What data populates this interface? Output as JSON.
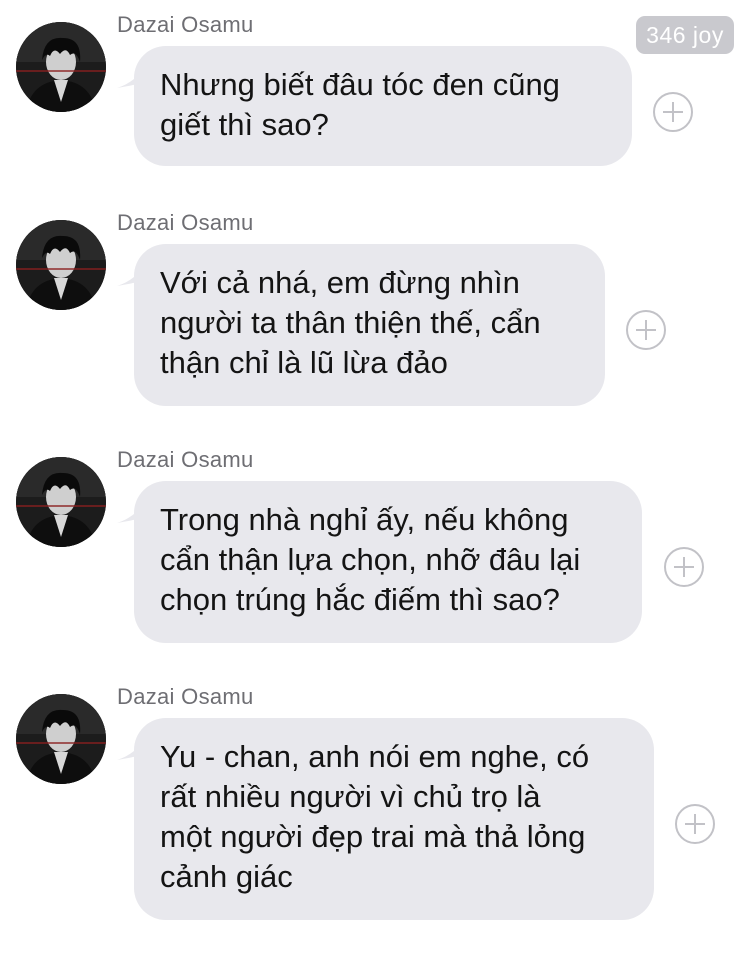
{
  "badge": {
    "label": "346 joy"
  },
  "messages": [
    {
      "sender": "Dazai Osamu",
      "text": "Nhưng biết đâu tóc đen cũng\ngiết thì sao?"
    },
    {
      "sender": "Dazai Osamu",
      "text": "Với cả nhá, em đừng nhìn\nngười ta thân thiện thế, cẩn\nthận chỉ là lũ lừa đảo"
    },
    {
      "sender": "Dazai Osamu",
      "text": "Trong nhà nghỉ ấy, nếu không\ncẩn thận lựa chọn, nhỡ đâu lại\nchọn trúng hắc điếm thì sao?"
    },
    {
      "sender": "Dazai Osamu",
      "text": "Yu - chan, anh nói em nghe, có\nrất nhiều người vì chủ trọ là\nmột người đẹp trai mà thả lỏng\ncảnh giác"
    }
  ],
  "icons": {
    "avatar": "avatar-portrait-icon",
    "add": "plus-circle-icon"
  },
  "colors": {
    "bubble": "#e8e8ed",
    "badge": "#c9c9ce",
    "sender": "#6e6e73",
    "plus": "#c2c2c7"
  }
}
